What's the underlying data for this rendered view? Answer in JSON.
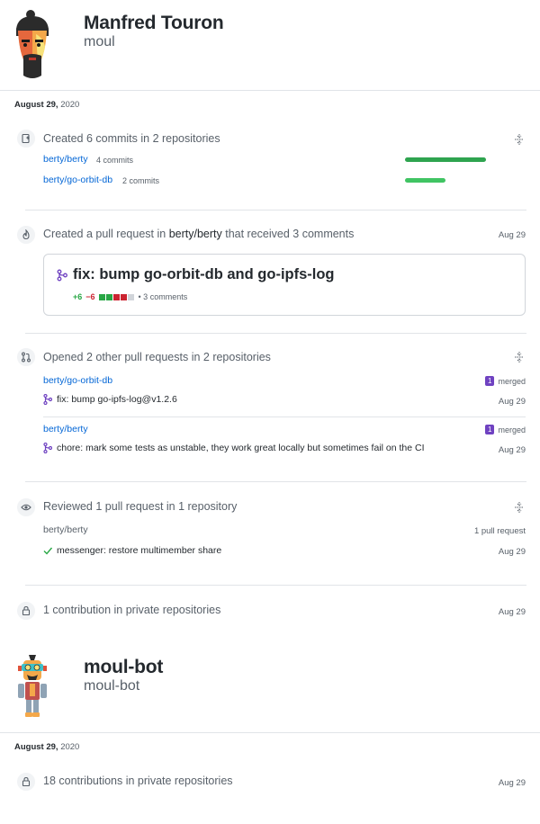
{
  "users": [
    {
      "name": "Manfred Touron",
      "login": "moul",
      "date_label": "August 29,",
      "date_year": "2020"
    },
    {
      "name": "moul-bot",
      "login": "moul-bot",
      "date_label": "August 29,",
      "date_year": "2020"
    }
  ],
  "commits": {
    "summary": "Created 6 commits in 2 repositories",
    "repos": [
      {
        "repo": "berty/berty",
        "count": "4 commits",
        "bar_fraction": 0.67,
        "color": "#2ea44f"
      },
      {
        "repo": "berty/go-orbit-db",
        "count": "2 commits",
        "bar_fraction": 0.33,
        "color": "#40c463"
      }
    ]
  },
  "pull_request": {
    "summary_prefix": "Created a pull request in",
    "repo": "berty/berty",
    "summary_suffix": "that received 3 comments",
    "date": "Aug 29",
    "title": "fix: bump go-orbit-db and go-ipfs-log",
    "additions": "+6",
    "deletions": "−6",
    "comments": "• 3 comments"
  },
  "opened": {
    "summary": "Opened 2 other pull requests in 2 repositories",
    "items": [
      {
        "repo": "berty/go-orbit-db",
        "badge": "1",
        "state": "merged",
        "title": "fix: bump go-ipfs-log@v1.2.6",
        "date": "Aug 29"
      },
      {
        "repo": "berty/berty",
        "badge": "1",
        "state": "merged",
        "title": "chore: mark some tests as unstable, they work great locally but sometimes fail on the CI",
        "date": "Aug 29"
      }
    ]
  },
  "reviewed": {
    "summary": "Reviewed 1 pull request in 1 repository",
    "repo": "berty/berty",
    "count": "1 pull request",
    "title": "messenger: restore multimember share",
    "date": "Aug 29"
  },
  "private1": {
    "summary": "1 contribution in private repositories",
    "date": "Aug 29"
  },
  "private2": {
    "summary": "18 contributions in private repositories",
    "date": "Aug 29"
  },
  "colors": {
    "link": "#0366d6",
    "merged": "#6f42c1",
    "add": "#28a745",
    "delete": "#cb2431"
  }
}
